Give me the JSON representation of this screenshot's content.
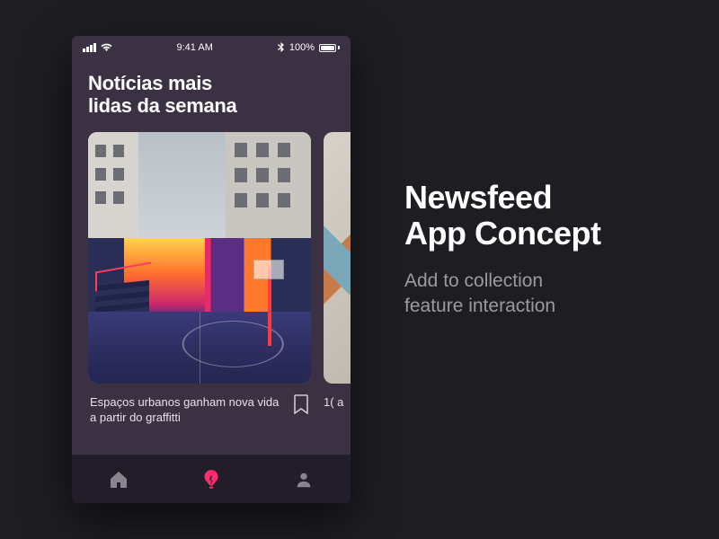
{
  "statusbar": {
    "time": "9:41 AM",
    "battery_pct": "100%"
  },
  "feed": {
    "heading_line1": "Notícias mais",
    "heading_line2": "lidas da semana",
    "cards": [
      {
        "title": "Espaços urbanos ganham nova vida a partir do graffitti"
      },
      {
        "title_fragment": "1(\na"
      }
    ]
  },
  "promo": {
    "title_line1": "Newsfeed",
    "title_line2": "App Concept",
    "subtitle_line1": "Add to collection",
    "subtitle_line2": "feature interaction"
  }
}
